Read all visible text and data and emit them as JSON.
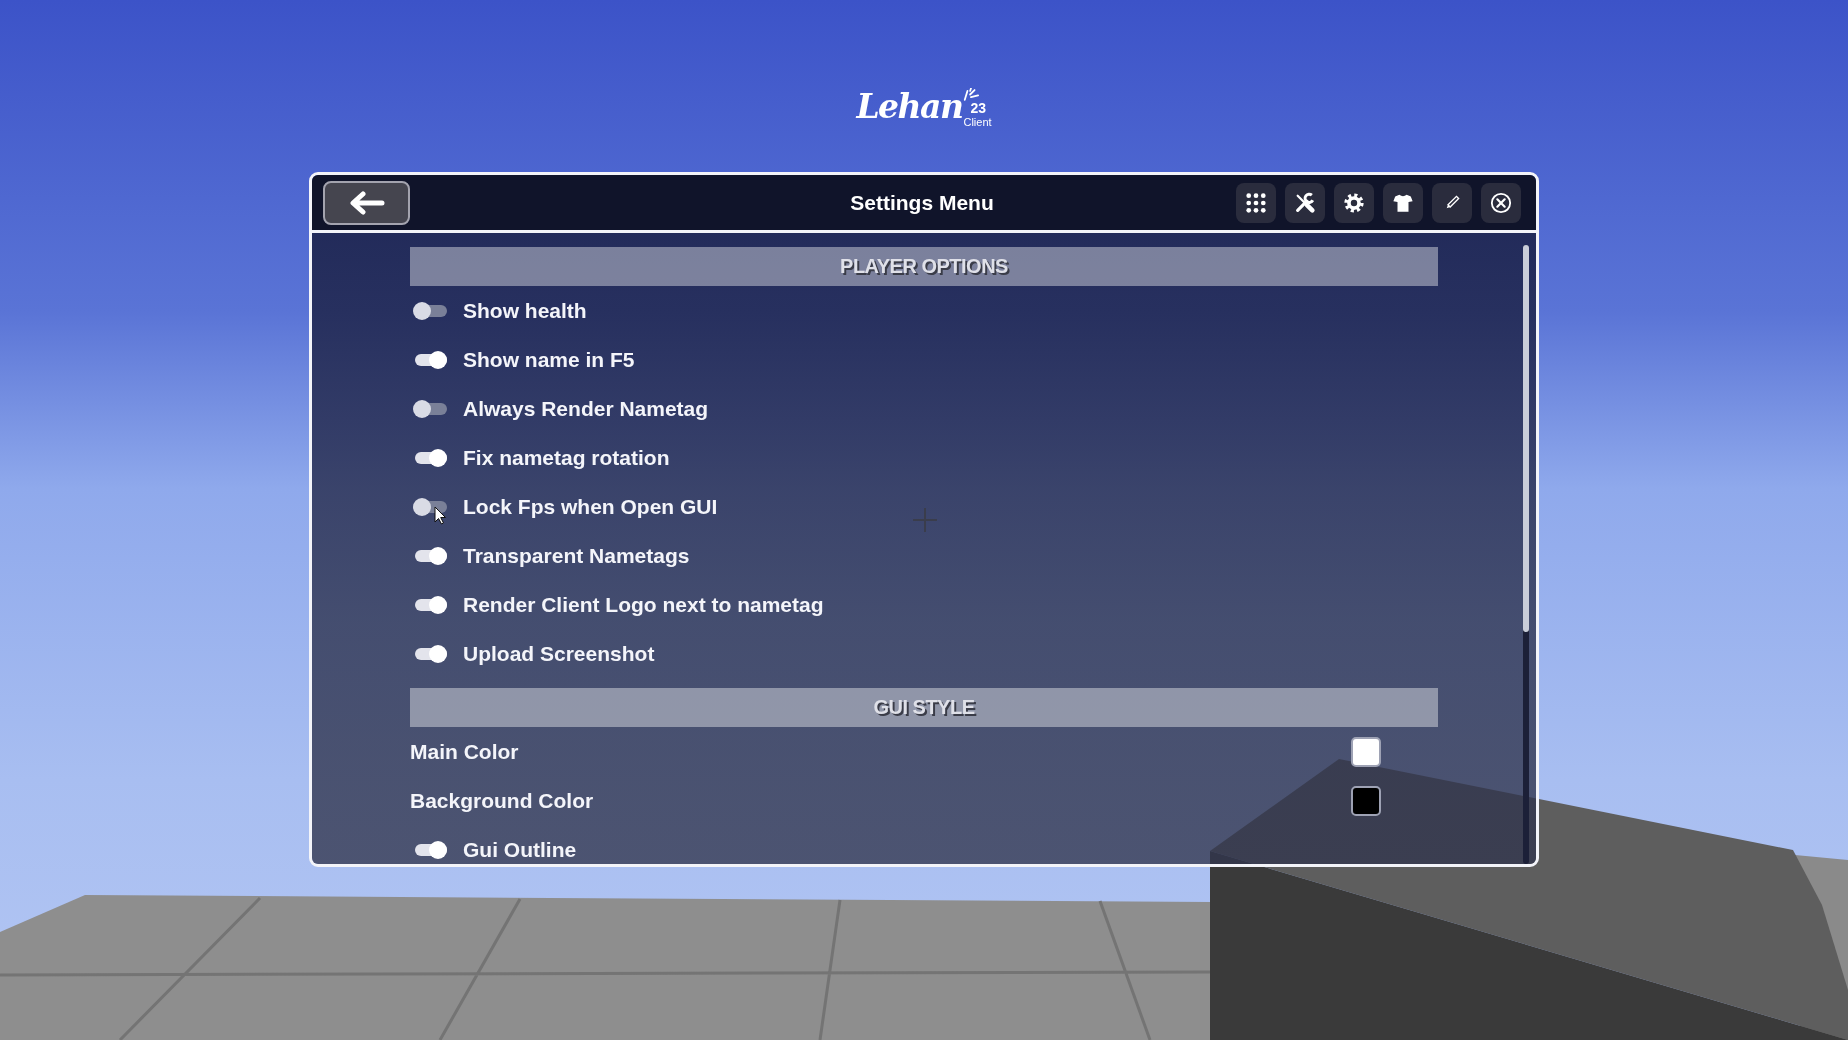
{
  "logo": {
    "title": "Lehan",
    "number": "23",
    "subtitle": "Client"
  },
  "window": {
    "title": "Settings Menu"
  },
  "sections": [
    {
      "title": "PLAYER OPTIONS",
      "items": [
        {
          "kind": "toggle",
          "label": "Show health",
          "on": false
        },
        {
          "kind": "toggle",
          "label": "Show name in F5",
          "on": true
        },
        {
          "kind": "toggle",
          "label": "Always Render Nametag",
          "on": false
        },
        {
          "kind": "toggle",
          "label": "Fix nametag rotation",
          "on": true
        },
        {
          "kind": "toggle",
          "label": "Lock Fps when Open GUI",
          "on": false
        },
        {
          "kind": "toggle",
          "label": "Transparent Nametags",
          "on": true
        },
        {
          "kind": "toggle",
          "label": "Render Client Logo next to nametag",
          "on": true
        },
        {
          "kind": "toggle",
          "label": "Upload Screenshot",
          "on": true
        }
      ]
    },
    {
      "title": "GUI STYLE",
      "items": [
        {
          "kind": "color",
          "label": "Main Color",
          "color": "#ffffff"
        },
        {
          "kind": "color",
          "label": "Background Color",
          "color": "#000000"
        },
        {
          "kind": "toggle",
          "label": "Gui Outline",
          "on": true
        }
      ]
    }
  ]
}
